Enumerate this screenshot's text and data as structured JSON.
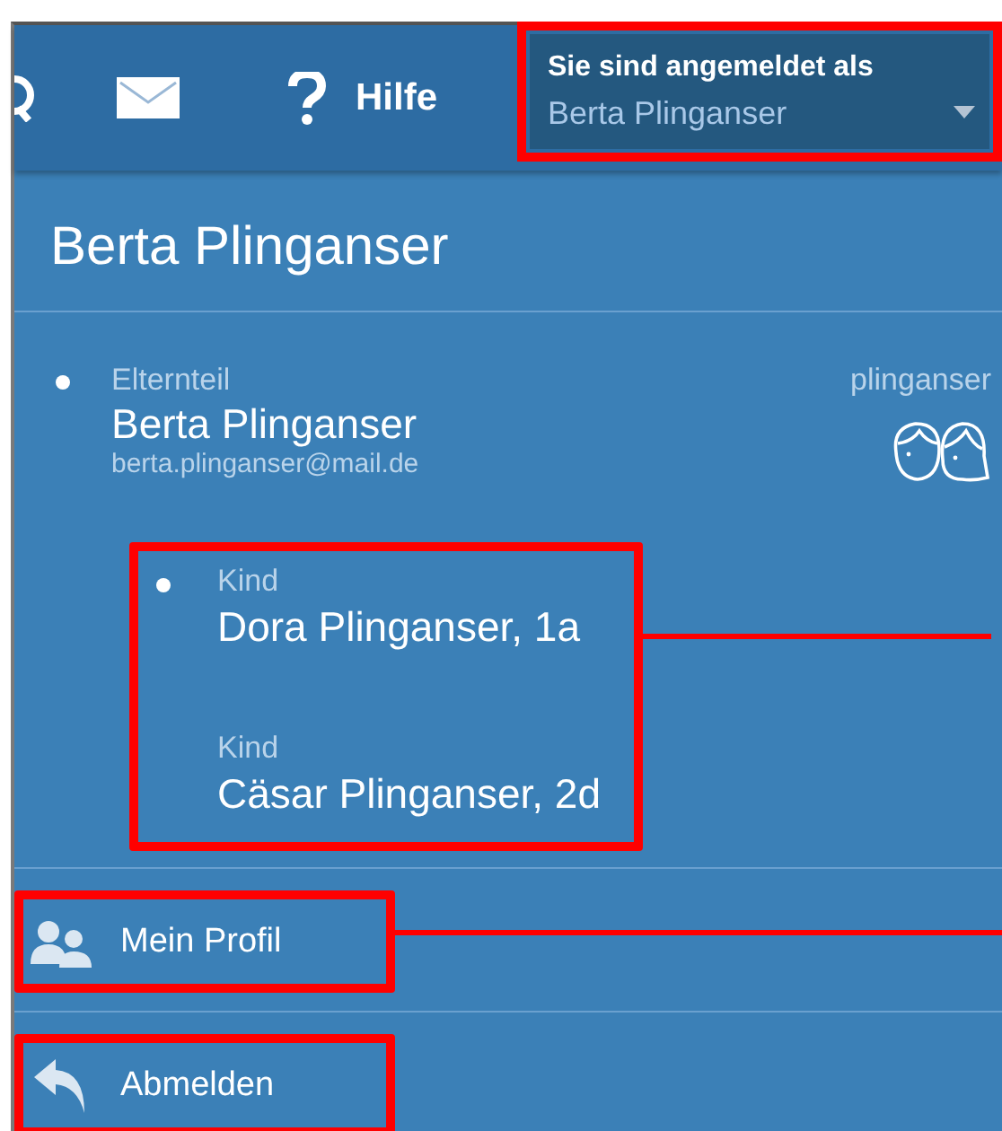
{
  "top_bar": {
    "items": [
      {
        "kind": "person"
      },
      {
        "kind": "mail"
      },
      {
        "kind": "help",
        "label": "Hilfe"
      }
    ],
    "account": {
      "caption": "Sie sind angemeldet als",
      "value": "Berta Plinganser",
      "highlighted": true
    }
  },
  "heading": "Berta Plinganser",
  "parent": {
    "role": "Elternteil",
    "name": "Berta Plinganser",
    "email": "berta.plinganser@mail.de",
    "username": "plinganser",
    "bullet": true,
    "children_highlighted": true,
    "children_pointer_line": true,
    "children": [
      {
        "role": "Kind",
        "name": "Dora Plinganser, 1a",
        "bullet": true
      },
      {
        "role": "Kind",
        "name": "Cäsar Plinganser, 2d",
        "bullet": false
      }
    ]
  },
  "menu": [
    {
      "kind": "profile",
      "label": "Mein Profil",
      "highlighted": true,
      "pointer_line": true
    },
    {
      "kind": "logout",
      "label": "Abmelden",
      "highlighted": true,
      "pointer_line": false
    }
  ]
}
